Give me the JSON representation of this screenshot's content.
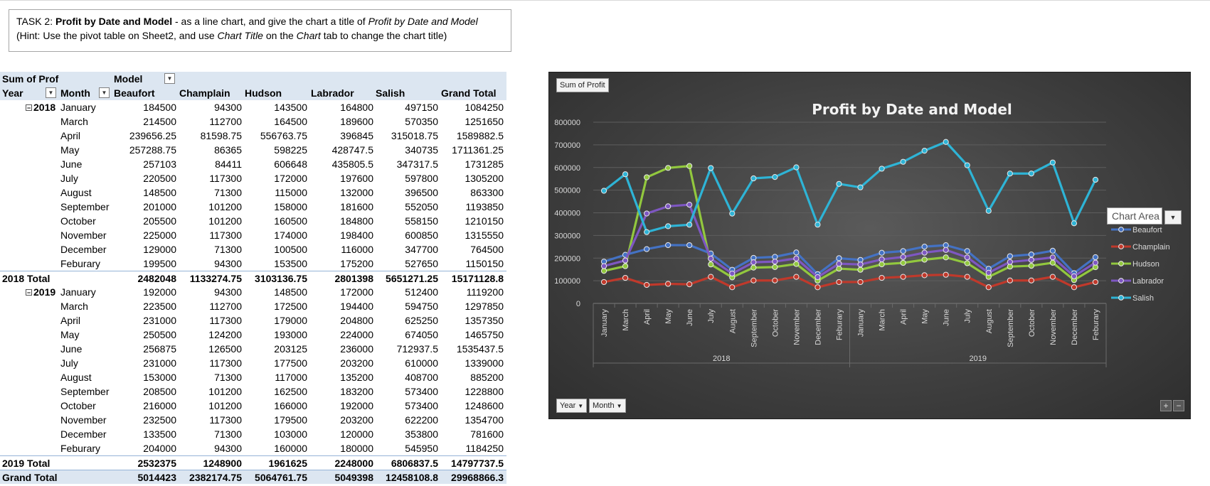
{
  "task": {
    "prefix": "TASK 2: ",
    "bold": "Profit by Date and Model",
    "mid": " - as a line chart, and give the chart a title of ",
    "italic": "Profit by Date and Model",
    "hint_a": "(Hint: Use the pivot table on Sheet2, and use ",
    "hint_b": "Chart Title",
    "hint_c": " on the ",
    "hint_d": "Chart",
    "hint_e": " tab to change the chart title)"
  },
  "pivot": {
    "header1": {
      "value_label": "Sum of Profi",
      "col_label": "Model"
    },
    "header2": {
      "year": "Year",
      "month": "Month",
      "cols": [
        "Beaufort",
        "Champlain",
        "Hudson",
        "Labrador",
        "Salish",
        "Grand Total"
      ]
    },
    "collapse_symbol": "⊟",
    "filter_symbol": "▼",
    "groups": [
      {
        "year": "2018",
        "rows": [
          {
            "month": "January",
            "vals": [
              "184500",
              "94300",
              "143500",
              "164800",
              "497150",
              "1084250"
            ]
          },
          {
            "month": "March",
            "vals": [
              "214500",
              "112700",
              "164500",
              "189600",
              "570350",
              "1251650"
            ]
          },
          {
            "month": "April",
            "vals": [
              "239656.25",
              "81598.75",
              "556763.75",
              "396845",
              "315018.75",
              "1589882.5"
            ]
          },
          {
            "month": "May",
            "vals": [
              "257288.75",
              "86365",
              "598225",
              "428747.5",
              "340735",
              "1711361.25"
            ]
          },
          {
            "month": "June",
            "vals": [
              "257103",
              "84411",
              "606648",
              "435805.5",
              "347317.5",
              "1731285"
            ]
          },
          {
            "month": "July",
            "vals": [
              "220500",
              "117300",
              "172000",
              "197600",
              "597800",
              "1305200"
            ]
          },
          {
            "month": "August",
            "vals": [
              "148500",
              "71300",
              "115000",
              "132000",
              "396500",
              "863300"
            ]
          },
          {
            "month": "September",
            "vals": [
              "201000",
              "101200",
              "158000",
              "181600",
              "552050",
              "1193850"
            ]
          },
          {
            "month": "October",
            "vals": [
              "205500",
              "101200",
              "160500",
              "184800",
              "558150",
              "1210150"
            ]
          },
          {
            "month": "November",
            "vals": [
              "225000",
              "117300",
              "174000",
              "198400",
              "600850",
              "1315550"
            ]
          },
          {
            "month": "December",
            "vals": [
              "129000",
              "71300",
              "100500",
              "116000",
              "347700",
              "764500"
            ]
          },
          {
            "month": "Feburary",
            "vals": [
              "199500",
              "94300",
              "153500",
              "175200",
              "527650",
              "1150150"
            ]
          }
        ],
        "total_label": "2018 Total",
        "total": [
          "2482048",
          "1133274.75",
          "3103136.75",
          "2801398",
          "5651271.25",
          "15171128.8"
        ]
      },
      {
        "year": "2019",
        "rows": [
          {
            "month": "January",
            "vals": [
              "192000",
              "94300",
              "148500",
              "172000",
              "512400",
              "1119200"
            ]
          },
          {
            "month": "March",
            "vals": [
              "223500",
              "112700",
              "172500",
              "194400",
              "594750",
              "1297850"
            ]
          },
          {
            "month": "April",
            "vals": [
              "231000",
              "117300",
              "179000",
              "204800",
              "625250",
              "1357350"
            ]
          },
          {
            "month": "May",
            "vals": [
              "250500",
              "124200",
              "193000",
              "224000",
              "674050",
              "1465750"
            ]
          },
          {
            "month": "June",
            "vals": [
              "256875",
              "126500",
              "203125",
              "236000",
              "712937.5",
              "1535437.5"
            ]
          },
          {
            "month": "July",
            "vals": [
              "231000",
              "117300",
              "177500",
              "203200",
              "610000",
              "1339000"
            ]
          },
          {
            "month": "August",
            "vals": [
              "153000",
              "71300",
              "117000",
              "135200",
              "408700",
              "885200"
            ]
          },
          {
            "month": "September",
            "vals": [
              "208500",
              "101200",
              "162500",
              "183200",
              "573400",
              "1228800"
            ]
          },
          {
            "month": "October",
            "vals": [
              "216000",
              "101200",
              "166000",
              "192000",
              "573400",
              "1248600"
            ]
          },
          {
            "month": "November",
            "vals": [
              "232500",
              "117300",
              "179500",
              "203200",
              "622200",
              "1354700"
            ]
          },
          {
            "month": "December",
            "vals": [
              "133500",
              "71300",
              "103000",
              "120000",
              "353800",
              "781600"
            ]
          },
          {
            "month": "Feburary",
            "vals": [
              "204000",
              "94300",
              "160000",
              "180000",
              "545950",
              "1184250"
            ]
          }
        ],
        "total_label": "2019 Total",
        "total": [
          "2532375",
          "1248900",
          "1961625",
          "2248000",
          "6806837.5",
          "14797737.5"
        ]
      }
    ],
    "grand_label": "Grand Total",
    "grand": [
      "5014423",
      "2382174.75",
      "5064761.75",
      "5049398",
      "12458108.8",
      "29968866.3"
    ]
  },
  "chart": {
    "value_button": "Sum of Profit",
    "axis_buttons": [
      "Year",
      "Month"
    ],
    "tooltip": "Chart Area",
    "zoom": [
      "+",
      "−"
    ],
    "colors": {
      "Beaufort": "#4472c4",
      "Champlain": "#c0392b",
      "Hudson": "#92c83e",
      "Labrador": "#7e57c2",
      "Salish": "#2eb4d6",
      "background": "#3f3f3f"
    }
  },
  "chart_data": {
    "type": "line",
    "title": "Profit by Date and Model",
    "ylim": [
      0,
      800000
    ],
    "yticks": [
      0,
      100000,
      200000,
      300000,
      400000,
      500000,
      600000,
      700000,
      800000
    ],
    "grid": true,
    "legend": "right",
    "groups": [
      "2018",
      "2019"
    ],
    "categories": [
      "January",
      "March",
      "April",
      "May",
      "June",
      "July",
      "August",
      "September",
      "October",
      "November",
      "December",
      "Feburary",
      "January",
      "March",
      "April",
      "May",
      "June",
      "July",
      "August",
      "September",
      "October",
      "November",
      "December",
      "Feburary"
    ],
    "series": [
      {
        "name": "Beaufort",
        "values": [
          184500,
          214500,
          239656.25,
          257288.75,
          257103,
          220500,
          148500,
          201000,
          205500,
          225000,
          129000,
          199500,
          192000,
          223500,
          231000,
          250500,
          256875,
          231000,
          153000,
          208500,
          216000,
          232500,
          133500,
          204000
        ]
      },
      {
        "name": "Champlain",
        "values": [
          94300,
          112700,
          81598.75,
          86365,
          84411,
          117300,
          71300,
          101200,
          101200,
          117300,
          71300,
          94300,
          94300,
          112700,
          117300,
          124200,
          126500,
          117300,
          71300,
          101200,
          101200,
          117300,
          71300,
          94300
        ]
      },
      {
        "name": "Hudson",
        "values": [
          143500,
          164500,
          556763.75,
          598225,
          606648,
          172000,
          115000,
          158000,
          160500,
          174000,
          100500,
          153500,
          148500,
          172500,
          179000,
          193000,
          203125,
          177500,
          117000,
          162500,
          166000,
          179500,
          103000,
          160000
        ]
      },
      {
        "name": "Labrador",
        "values": [
          164800,
          189600,
          396845,
          428747.5,
          435805.5,
          197600,
          132000,
          181600,
          184800,
          198400,
          116000,
          175200,
          172000,
          194400,
          204800,
          224000,
          236000,
          203200,
          135200,
          183200,
          192000,
          203200,
          120000,
          180000
        ]
      },
      {
        "name": "Salish",
        "values": [
          497150,
          570350,
          315018.75,
          340735,
          347317.5,
          597800,
          396500,
          552050,
          558150,
          600850,
          347700,
          527650,
          512400,
          594750,
          625250,
          674050,
          712937.5,
          610000,
          408700,
          573400,
          573400,
          622200,
          353800,
          545950
        ]
      }
    ]
  }
}
